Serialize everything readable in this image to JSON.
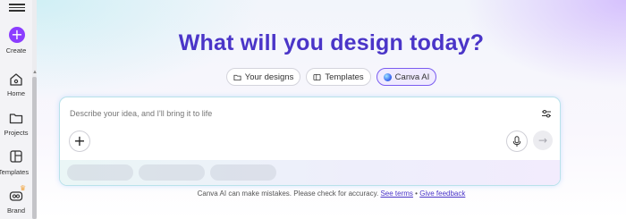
{
  "sidebar": {
    "create_label": "Create",
    "items": [
      {
        "label": "Home",
        "icon": "home-icon"
      },
      {
        "label": "Projects",
        "icon": "folder-icon"
      },
      {
        "label": "Templates",
        "icon": "templates-icon"
      },
      {
        "label": "Brand",
        "icon": "brand-icon"
      }
    ],
    "accent_color": "#8b3dff"
  },
  "headline": "What will you design today?",
  "tabs": [
    {
      "label": "Your designs",
      "icon": "folder-icon"
    },
    {
      "label": "Templates",
      "icon": "templates-icon"
    },
    {
      "label": "Canva AI",
      "icon": "canva-ai-icon",
      "active": true
    }
  ],
  "prompt": {
    "placeholder": "Describe your idea, and I'll bring it to life"
  },
  "footer": {
    "text": "Canva AI can make mistakes. Please check for accuracy.",
    "terms_link": "See terms",
    "separator": "•",
    "feedback_link": "Give feedback"
  }
}
